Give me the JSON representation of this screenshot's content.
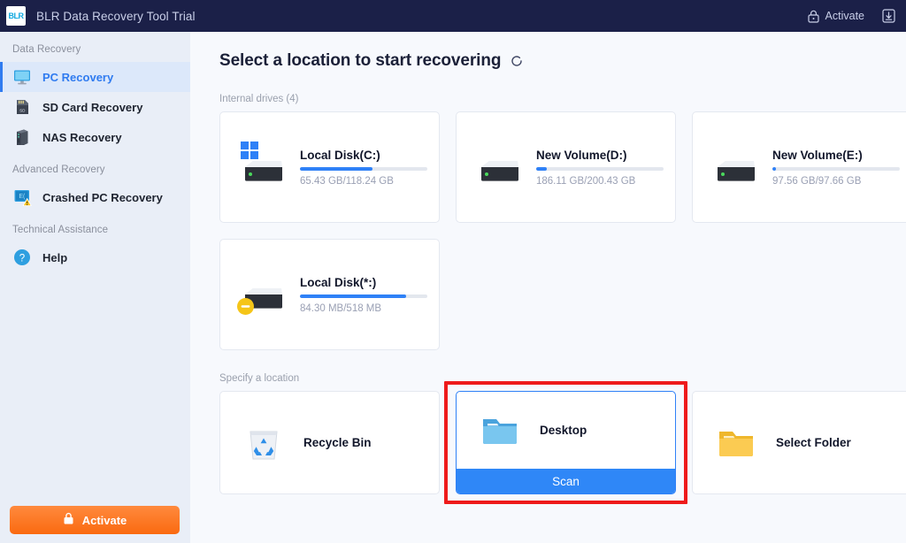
{
  "titlebar": {
    "logo_text": "BLR",
    "title": "BLR Data Recovery Tool Trial",
    "activate_label": "Activate",
    "lock_icon": "lock-icon",
    "download_icon": "download-icon"
  },
  "sidebar": {
    "groups": [
      {
        "label": "Data Recovery",
        "items": [
          {
            "label": "PC Recovery",
            "icon": "monitor-icon",
            "active": true
          },
          {
            "label": "SD Card Recovery",
            "icon": "sd-card-icon",
            "active": false
          },
          {
            "label": "NAS Recovery",
            "icon": "server-icon",
            "active": false
          }
        ]
      },
      {
        "label": "Advanced Recovery",
        "items": [
          {
            "label": "Crashed PC Recovery",
            "icon": "crashed-pc-icon",
            "active": false
          }
        ]
      },
      {
        "label": "Technical Assistance",
        "items": [
          {
            "label": "Help",
            "icon": "help-icon",
            "active": false
          }
        ]
      }
    ],
    "activate_button": {
      "label": "Activate",
      "icon": "lock-icon",
      "color": "#fa6a10"
    }
  },
  "main": {
    "page_title": "Select a location to start recovering",
    "refresh_icon": "refresh-icon",
    "internal_drives_label": "Internal drives (4)",
    "drives": [
      {
        "name": "Local Disk(C:)",
        "size_text": "65.43 GB/118.24 GB",
        "fill_percent": 57,
        "badge": "windows-logo-badge"
      },
      {
        "name": "New Volume(D:)",
        "size_text": "186.11 GB/200.43 GB",
        "fill_percent": 8,
        "badge": ""
      },
      {
        "name": "New Volume(E:)",
        "size_text": "97.56 GB/97.66 GB",
        "fill_percent": 3,
        "badge": ""
      },
      {
        "name": "Local Disk(*:)",
        "size_text": "84.30 MB/518 MB",
        "fill_percent": 83,
        "badge": "warning-badge"
      }
    ],
    "specify_location_label": "Specify a location",
    "locations": [
      {
        "name": "Recycle Bin",
        "icon": "recycle-bin-icon",
        "selected": false
      },
      {
        "name": "Desktop",
        "icon": "folder-blue-icon",
        "selected": true,
        "action_label": "Scan"
      },
      {
        "name": "Select Folder",
        "icon": "folder-yellow-icon",
        "selected": false
      }
    ],
    "accent_color": "#2f81f7",
    "annotation_color": "#ee1b1b"
  }
}
